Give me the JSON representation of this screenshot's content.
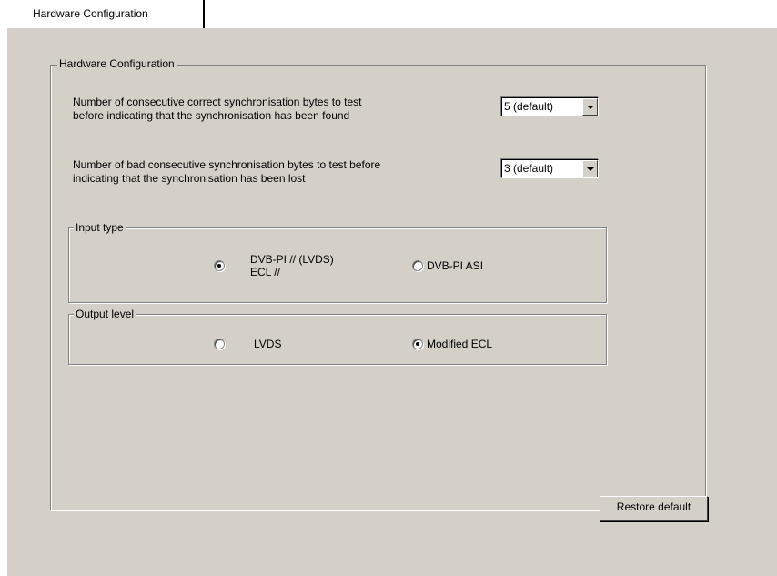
{
  "tab": {
    "label": "Hardware Configuration"
  },
  "group": {
    "title": "Hardware Configuration"
  },
  "sync_found": {
    "line1": "Number of consecutive correct synchronisation bytes to test",
    "line2": "before indicating that the synchronisation has been found",
    "value": "5 (default)"
  },
  "sync_lost": {
    "line1": "Number of bad consecutive synchronisation bytes to test before",
    "line2": "indicating that the synchronisation has been lost",
    "value": "3 (default)"
  },
  "input_type": {
    "title": "Input type",
    "options": [
      {
        "line1": "DVB-PI // (LVDS)",
        "line2": "ECL //",
        "checked": true
      },
      {
        "label": "DVB-PI ASI",
        "checked": false
      }
    ]
  },
  "output_level": {
    "title": "Output level",
    "options": [
      {
        "label": "LVDS",
        "checked": false
      },
      {
        "label": "Modified ECL",
        "checked": true
      }
    ]
  },
  "restore_button": {
    "label": "Restore default"
  }
}
